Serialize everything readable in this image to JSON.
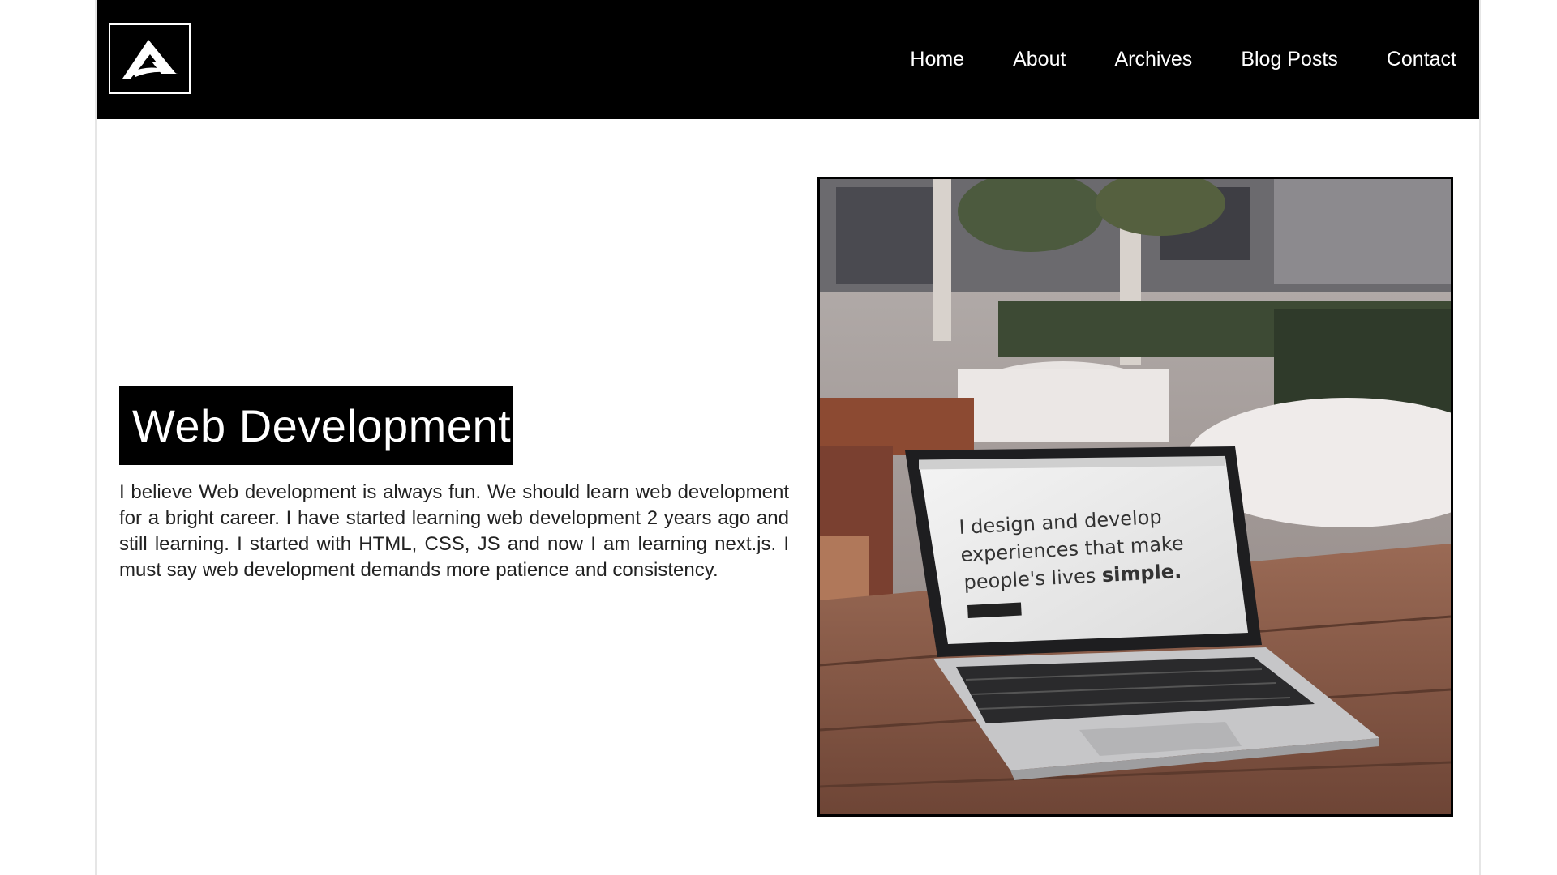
{
  "nav": {
    "logo_icon": "triangle-logo-icon",
    "links": [
      {
        "label": "Home"
      },
      {
        "label": "About"
      },
      {
        "label": "Archives"
      },
      {
        "label": "Blog Posts"
      },
      {
        "label": "Contact"
      }
    ]
  },
  "hero": {
    "title": "Web Development",
    "description": "I believe Web development is always fun. We should learn web development for a bright career. I have started learning web development 2 years ago and still learning. I started with HTML, CSS, JS and now I am learning next.js. I must say web development demands more patience and consistency.",
    "image": {
      "screen_line1": "I design and develop",
      "screen_line2": "experiences that make",
      "screen_line3_prefix": "people's lives ",
      "screen_line3_bold": "simple."
    }
  },
  "colors": {
    "nav_background": "#000000",
    "nav_text": "#ffffff",
    "heading_background": "#000000",
    "body_text": "#222222"
  }
}
